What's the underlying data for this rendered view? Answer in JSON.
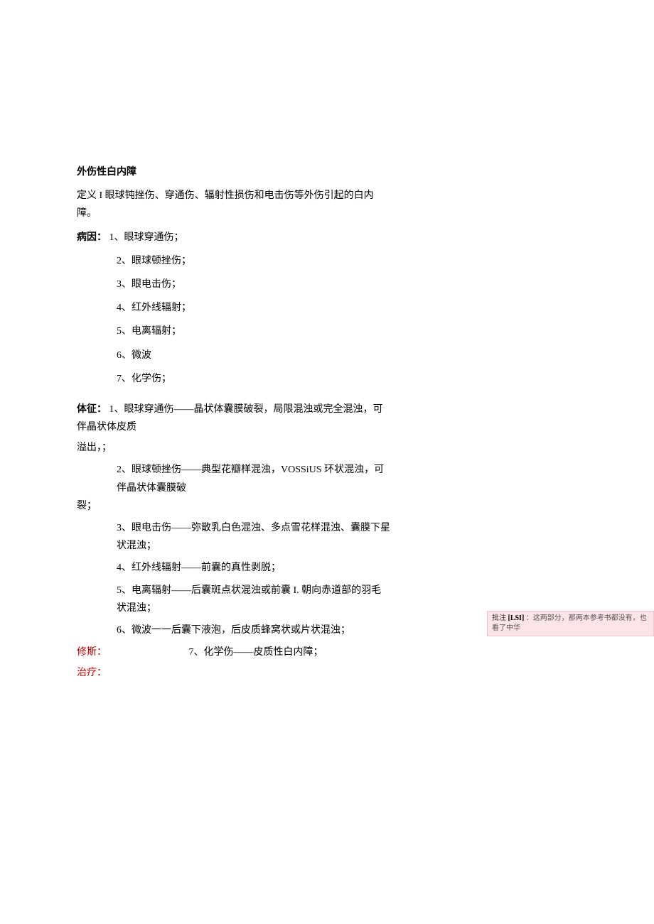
{
  "title": "外伤性白内障",
  "definition": "定义 I 眼球钝挫伤、穿通伤、辐射性损伤和电击伤等外伤引起的白内障。",
  "causes": {
    "label": "病因：",
    "items": [
      "1、眼球穿通伤；",
      "2、眼球顿挫伤；",
      "3、眼电击伤；",
      "4、红外线辐射；",
      "5、电离辐射；",
      "6、微波",
      "7、化学伤；"
    ]
  },
  "signs": {
    "label": "体征：",
    "item1_line1": "1、眼球穿通伤——晶状体囊膜破裂，局限混浊或完全混浊，可伴晶状体皮质",
    "item1_line2": "溢出，；",
    "item2_line1": "2、眼球顿挫伤——典型花瓣样混浊，VOSSiUS 环状混浊，可伴晶状体囊膜破",
    "item2_line2": "裂；",
    "item3": "3、眼电击伤——弥散乳白色混浊、多点雪花样混浊、囊膜下星状混浊；",
    "item4": "4、红外线辐射——前囊的真性剥脱；",
    "item5": "5、电离辐射——后囊斑点状混浊或前囊 I. 朝向赤道部的羽毛状混浊；",
    "item6": "6、微波一一后囊下液泡，后皮质蜂窝状或片状混浊；",
    "item7": "7、化学伤——皮质性白内障；"
  },
  "red_labels": {
    "xiusi": "修斯：",
    "zhiliao": "治疗："
  },
  "comment": {
    "prefix": "批注",
    "tag": " [LSI] ",
    "colon": "：",
    "text": "这两部分，那两本参考书都没有，也看了中华"
  }
}
